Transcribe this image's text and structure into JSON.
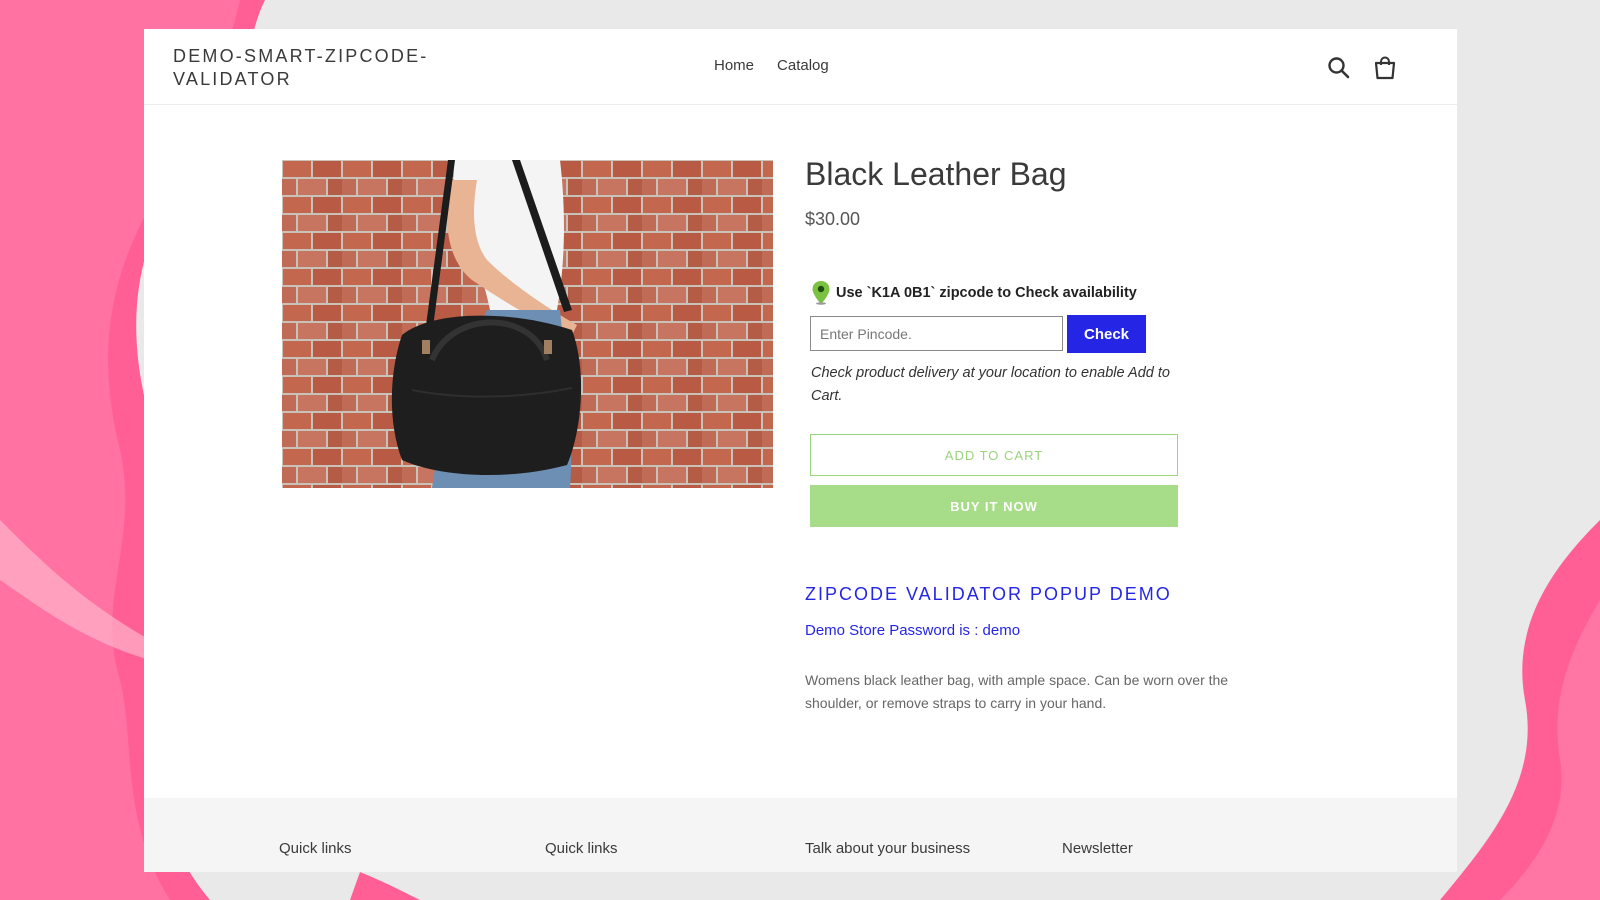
{
  "header": {
    "logo": "DEMO-SMART-ZIPCODE-VALIDATOR",
    "nav": [
      "Home",
      "Catalog"
    ],
    "icons": [
      "search-icon",
      "cart-icon"
    ]
  },
  "product": {
    "title": "Black Leather Bag",
    "price": "$30.00",
    "image_icon": "product-photo-bag",
    "zip_prompt": "Use `K1A 0B1` zipcode to Check availability",
    "pincode_placeholder": "Enter Pincode.",
    "check_label": "Check",
    "delivery_note": "Check product delivery at your location to enable Add to Cart.",
    "add_to_cart": "ADD TO CART",
    "buy_now": "BUY IT NOW",
    "section_heading": "ZIPCODE VALIDATOR POPUP DEMO",
    "password_text": "Demo Store Password is : demo",
    "description": "Womens black leather bag, with ample space. Can be worn over the shoulder, or remove straps to carry in your hand."
  },
  "footer": {
    "columns": [
      "Quick links",
      "Quick links",
      "Talk about your business",
      "Newsletter"
    ]
  },
  "colors": {
    "accent_blue": "#2525e6",
    "buy_green": "#a7dc89",
    "pin_green": "#7cc242",
    "background_pink": "#ff5f95"
  }
}
